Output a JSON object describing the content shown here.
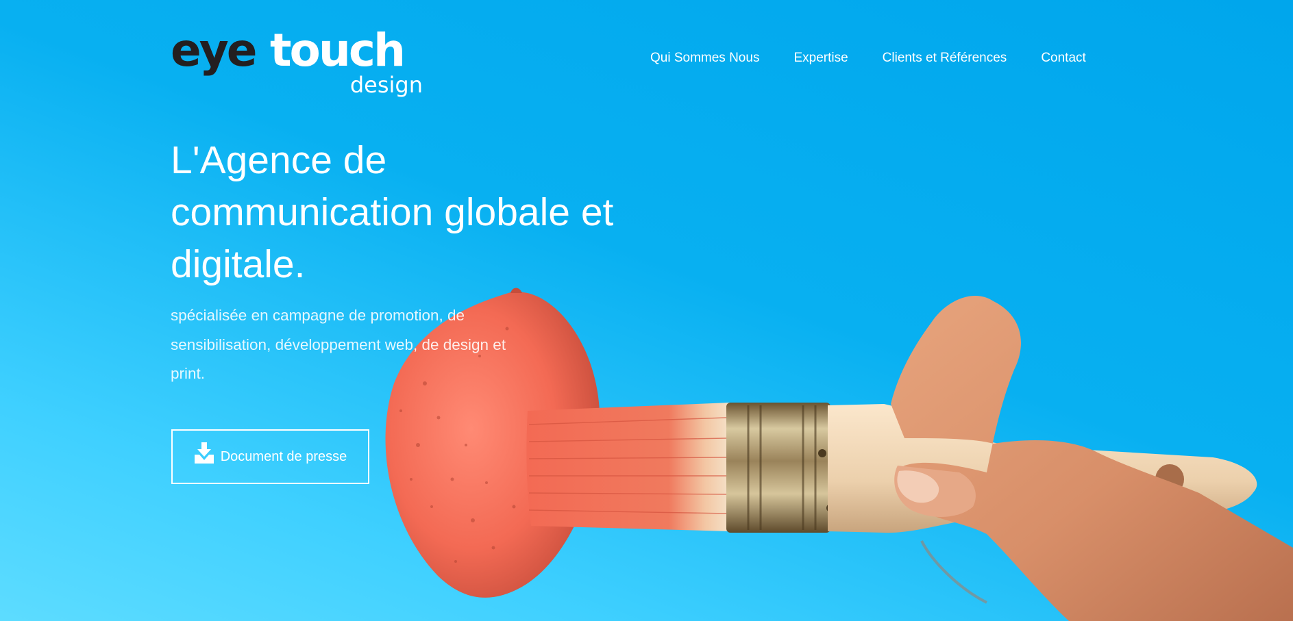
{
  "logo": {
    "text_eye": "eye",
    "text_touch": "touch",
    "text_design": "design"
  },
  "nav": {
    "items": [
      {
        "label": "Qui Sommes Nous"
      },
      {
        "label": "Expertise"
      },
      {
        "label": "Clients et Références"
      },
      {
        "label": "Contact"
      }
    ]
  },
  "hero": {
    "headline_lines": [
      "L'Agence de",
      "communication globale et",
      "digitale."
    ],
    "subtitle_lines": [
      "spécialisée en campagne de promotion, de",
      "sensibilisation, développement web, de design et",
      "print."
    ],
    "button_label": "Document de presse",
    "button_icon": "download-icon"
  },
  "colors": {
    "background": "#00a6ec",
    "accent_coral": "#f36a54",
    "logo_dark": "#231f20",
    "text": "#ffffff"
  }
}
